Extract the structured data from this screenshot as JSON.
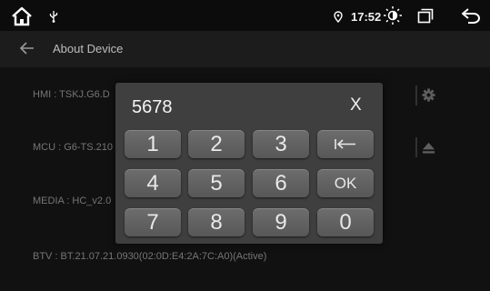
{
  "status_bar": {
    "time": "17:52",
    "icons": [
      "home-icon",
      "usb-icon",
      "location-icon",
      "brightness-icon",
      "recent-apps-icon",
      "back-icon"
    ]
  },
  "title_bar": {
    "back_icon": "arrow-left-icon",
    "title": "About Device"
  },
  "rows": {
    "hmi": "HMI : TSKJ.G6.D",
    "mcu": "MCU : G6-TS.210",
    "media": "MEDIA : HC_v2.0",
    "btv": "BTV : BT.21.07.21.0930(02:0D:E4:2A:7C:A0)(Active)"
  },
  "row_icons": [
    "gear-icon",
    "eject-icon"
  ],
  "dialog": {
    "input_value": "5678",
    "close_label": "X",
    "keys": [
      "1",
      "2",
      "3",
      "backspace",
      "4",
      "5",
      "6",
      "OK",
      "7",
      "8",
      "9",
      "0"
    ],
    "ok_label": "OK",
    "zero_label": "0"
  },
  "colors": {
    "background": "#141414",
    "dialog": "#3f3f3f",
    "key": "#606060"
  }
}
